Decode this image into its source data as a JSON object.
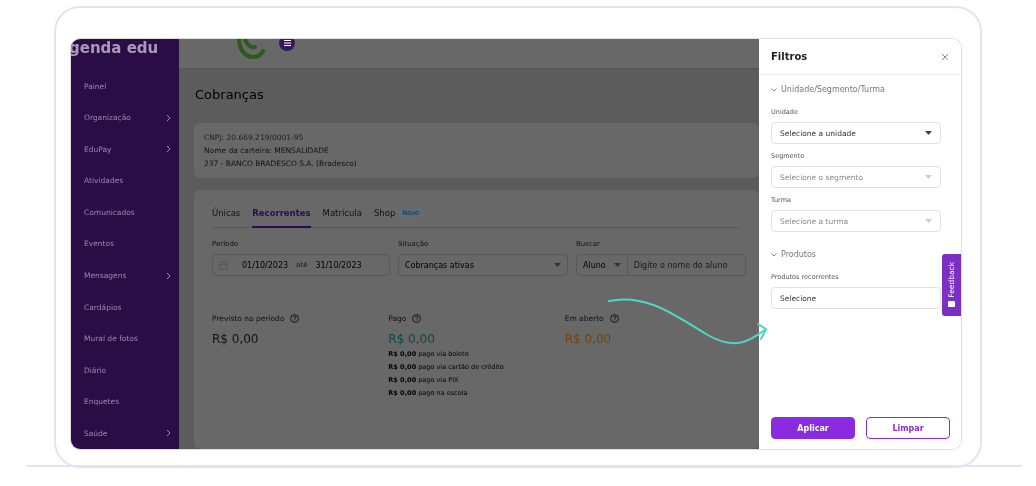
{
  "sidebar": {
    "logo": "genda edu",
    "items": [
      {
        "label": "Painel",
        "expandable": false
      },
      {
        "label": "Organização",
        "expandable": true
      },
      {
        "label": "EduPay",
        "expandable": true
      },
      {
        "label": "Atividades",
        "expandable": false
      },
      {
        "label": "Comunicados",
        "expandable": false
      },
      {
        "label": "Eventos",
        "expandable": false
      },
      {
        "label": "Mensagens",
        "expandable": true
      },
      {
        "label": "Cardápios",
        "expandable": false
      },
      {
        "label": "Mural de fotos",
        "expandable": false
      },
      {
        "label": "Diário",
        "expandable": false
      },
      {
        "label": "Enquetes",
        "expandable": false
      },
      {
        "label": "Saúde",
        "expandable": true
      }
    ]
  },
  "page": {
    "title": "Cobranças",
    "account": {
      "cnpj": "CNPJ: 20.669.219/0001-95",
      "wallet": "Nome da carteira: MENSALIDADE",
      "bank": "237 - BANCO BRADESCO S.A. (Bradesco)"
    },
    "tabs": [
      {
        "label": "Únicas",
        "selected": false
      },
      {
        "label": "Recorrentes",
        "selected": true
      },
      {
        "label": "Matrícula",
        "selected": false
      },
      {
        "label": "Shop",
        "selected": false,
        "badge": "Novo"
      }
    ],
    "filters": {
      "period_label": "Período",
      "date_from": "01/10/2023",
      "date_sep": "até",
      "date_to": "31/10/2023",
      "status_label": "Situação",
      "status_value": "Cobranças ativas",
      "search_label": "Buscar",
      "search_type": "Aluno",
      "search_placeholder": "Digite o nome do aluno"
    },
    "summary": [
      {
        "label": "Previsto no período",
        "value": "R$ 0,00",
        "color": "#111111"
      },
      {
        "label": "Pago",
        "value": "R$ 0,00",
        "color": "#0b4a46",
        "details": [
          {
            "amount": "R$ 0,00",
            "text": "pago via boleto"
          },
          {
            "amount": "R$ 0,00",
            "text": "pago via cartão de crédito"
          },
          {
            "amount": "R$ 0,00",
            "text": "pago via PIX"
          },
          {
            "amount": "R$ 0,00",
            "text": "pago na escola"
          }
        ]
      },
      {
        "label": "Em aberto",
        "value": "R$ 0,00",
        "color": "#6e4512"
      }
    ]
  },
  "drawer": {
    "title": "Filtros",
    "sections": [
      {
        "title": "Unidade/Segmento/Turma",
        "expanded": true,
        "fields": [
          {
            "label": "Unidade",
            "placeholder": "Selecione a unidade",
            "disabled": false,
            "kind": "select"
          },
          {
            "label": "Segmento",
            "placeholder": "Selecione o segmento",
            "disabled": true,
            "kind": "select"
          },
          {
            "label": "Turma",
            "placeholder": "Selecione a turma",
            "disabled": true,
            "kind": "select"
          }
        ]
      },
      {
        "title": "Produtos",
        "expanded": true,
        "fields": [
          {
            "label": "Produtos recorrentes",
            "placeholder": "Selecione",
            "disabled": false,
            "kind": "input"
          }
        ]
      }
    ],
    "apply": "Aplicar",
    "clear": "Limpar"
  },
  "feedback": "Feedback"
}
